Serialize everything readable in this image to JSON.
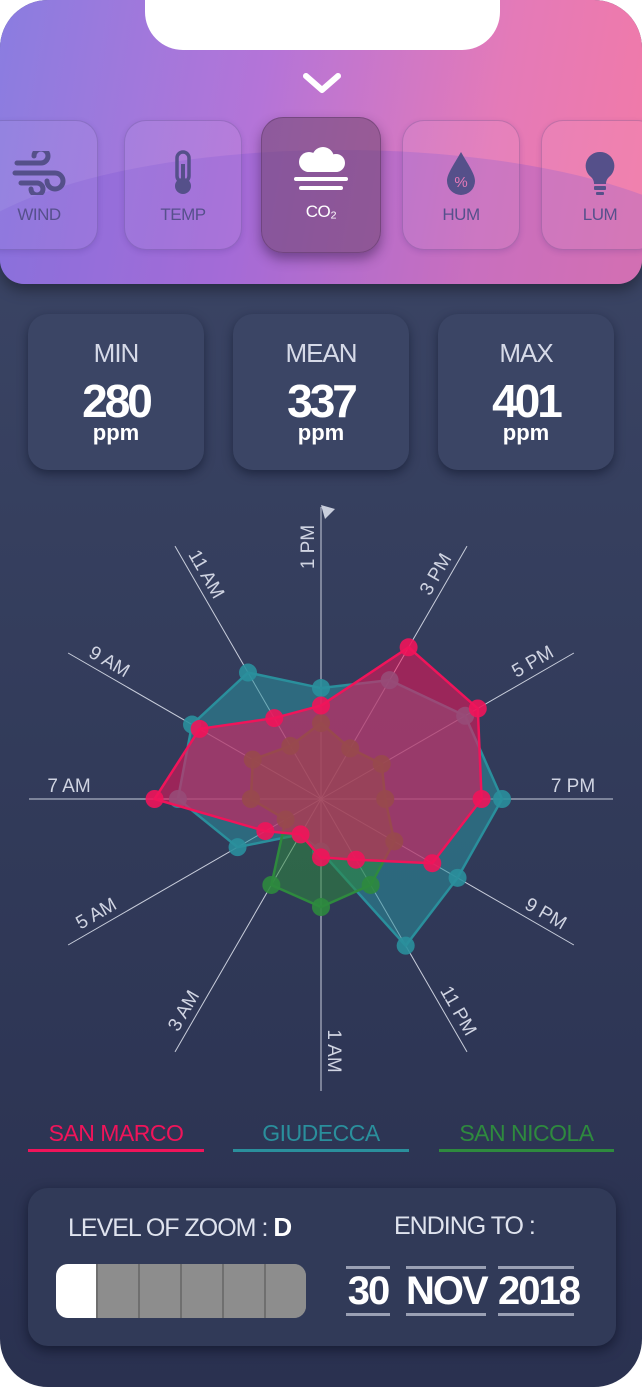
{
  "header": {
    "collapse_icon": "chevron-down-icon",
    "sensors": [
      {
        "label": "WIND",
        "icon": "wind-icon",
        "active": false
      },
      {
        "label": "TEMP",
        "icon": "thermometer-icon",
        "active": false
      },
      {
        "label": "CO₂",
        "icon": "cloud-icon",
        "active": true
      },
      {
        "label": "HUM",
        "icon": "droplet-percent-icon",
        "active": false
      },
      {
        "label": "LUM",
        "icon": "lightbulb-icon",
        "active": false
      }
    ]
  },
  "stats": {
    "min": {
      "title": "MIN",
      "value": "280",
      "unit": "ppm"
    },
    "mean": {
      "title": "MEAN",
      "value": "337",
      "unit": "ppm"
    },
    "max": {
      "title": "MAX",
      "value": "401",
      "unit": "ppm"
    }
  },
  "chart_data": {
    "type": "radar",
    "axes": [
      "1 PM",
      "3 PM",
      "5 PM",
      "7 PM",
      "9 PM",
      "11 PM",
      "1 AM",
      "3 AM",
      "5 AM",
      "7 AM",
      "9 AM",
      "11 AM"
    ],
    "series": [
      {
        "name": "SAN MARCO",
        "color": "#f0145a",
        "values": [
          0.32,
          0.6,
          0.62,
          0.55,
          0.44,
          0.24,
          0.2,
          0.14,
          0.22,
          0.57,
          0.48,
          0.32
        ]
      },
      {
        "name": "GIUDECCA",
        "color": "#2a8f9c",
        "values": [
          0.38,
          0.47,
          0.57,
          0.62,
          0.54,
          0.58,
          0.18,
          0.14,
          0.33,
          0.49,
          0.51,
          0.5
        ]
      },
      {
        "name": "SAN NICOLA",
        "color": "#2e8a3e",
        "values": [
          0.26,
          0.2,
          0.24,
          0.22,
          0.29,
          0.34,
          0.37,
          0.34,
          0.14,
          0.24,
          0.27,
          0.21
        ]
      }
    ]
  },
  "legend": [
    {
      "label": "SAN MARCO",
      "color": "#f0145a"
    },
    {
      "label": "GIUDECCA",
      "color": "#2a8f9c"
    },
    {
      "label": "SAN NICOLA",
      "color": "#2e8a3e"
    }
  ],
  "zoom": {
    "label": "LEVEL OF ZOOM : ",
    "level": "D",
    "segments_total": 6,
    "segments_active": 1,
    "ending_label": "ENDING TO :",
    "day": "30",
    "month": "NOV",
    "year": "2018"
  }
}
